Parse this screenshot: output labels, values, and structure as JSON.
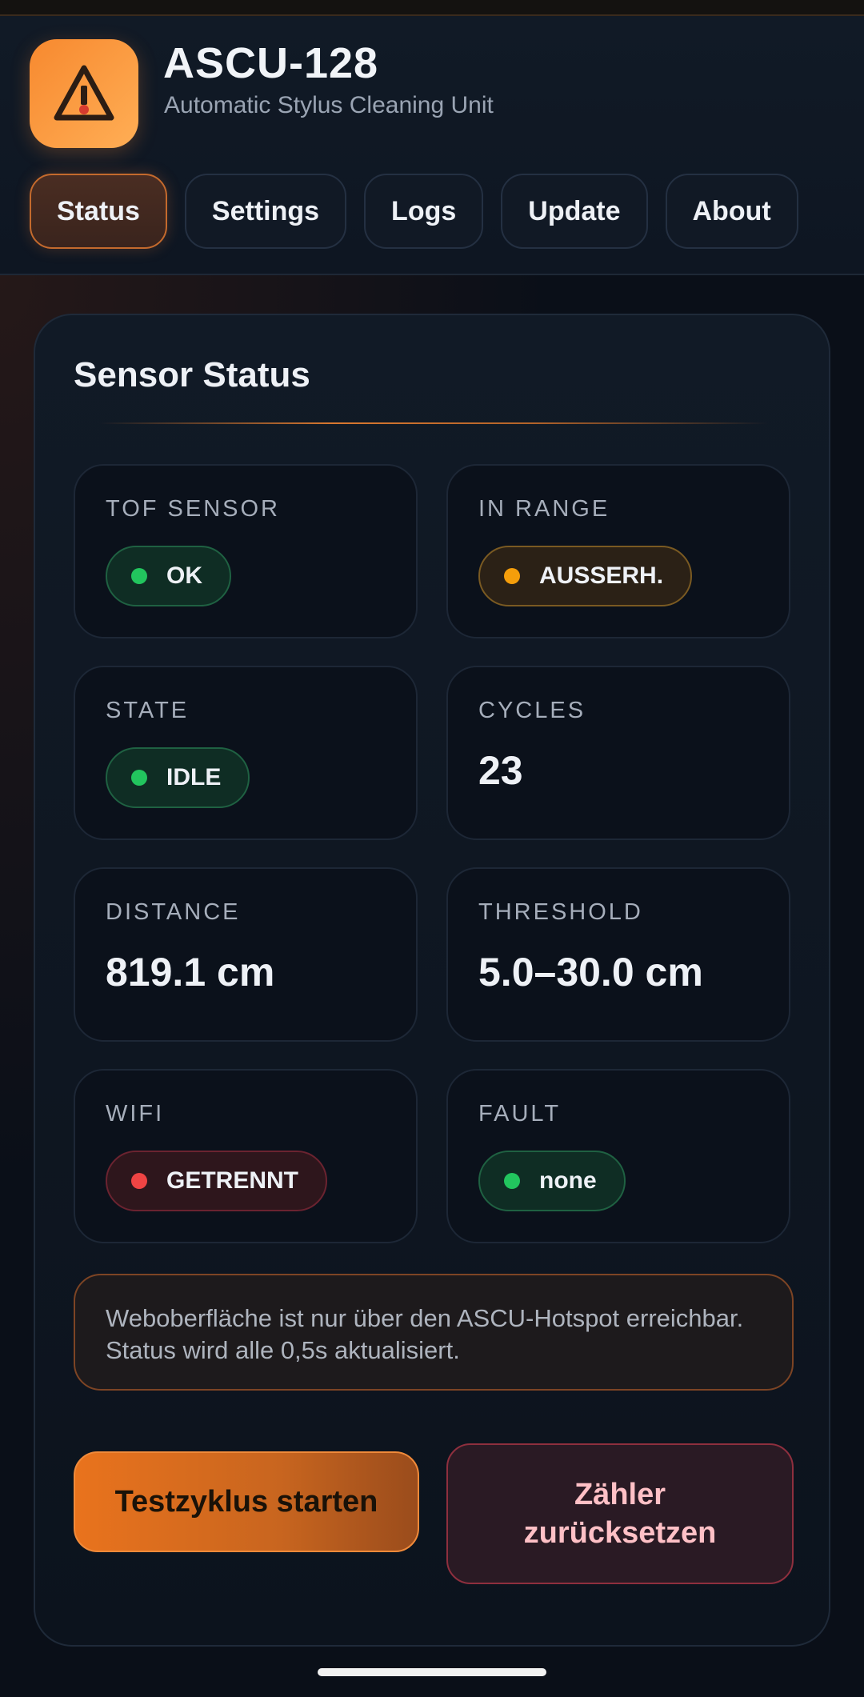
{
  "header": {
    "title": "ASCU-128",
    "subtitle": "Automatic Stylus Cleaning Unit",
    "logo_icon": "warning-triangle-icon"
  },
  "tabs": [
    {
      "label": "Status",
      "active": true
    },
    {
      "label": "Settings",
      "active": false
    },
    {
      "label": "Logs",
      "active": false
    },
    {
      "label": "Update",
      "active": false
    },
    {
      "label": "About",
      "active": false
    }
  ],
  "sensor_status": {
    "title": "Sensor Status",
    "tiles": {
      "tof_sensor": {
        "label": "TOF SENSOR",
        "value": "OK",
        "status": "green"
      },
      "in_range": {
        "label": "IN RANGE",
        "value": "AUSSERH.",
        "status": "amber"
      },
      "state": {
        "label": "STATE",
        "value": "IDLE",
        "status": "green"
      },
      "cycles": {
        "label": "CYCLES",
        "value": "23"
      },
      "distance": {
        "label": "DISTANCE",
        "value": "819.1 cm"
      },
      "threshold": {
        "label": "THRESHOLD",
        "value": "5.0–30.0 cm"
      },
      "wifi": {
        "label": "WIFI",
        "value": "GETRENNT",
        "status": "red"
      },
      "fault": {
        "label": "FAULT",
        "value": "none",
        "status": "green"
      }
    },
    "notice": "Weboberfläche ist nur über den ASCU-Hotspot erreichbar. Status wird alle 0,5s aktualisiert.",
    "buttons": {
      "test_cycle": "Testzyklus starten",
      "reset_counter": "Zähler zurücksetzen"
    }
  },
  "colors": {
    "accent": "#e9731d",
    "status_green": "#22c55e",
    "status_amber": "#f59e0b",
    "status_red": "#ef4444"
  }
}
